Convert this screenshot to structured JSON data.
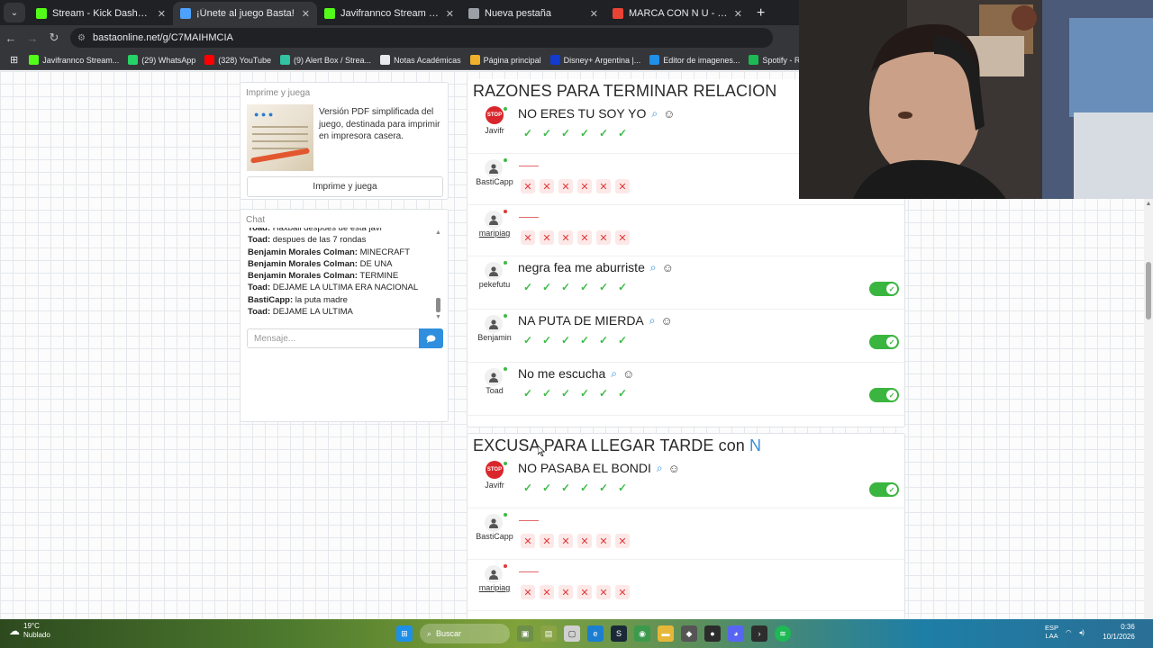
{
  "browser": {
    "tabs": [
      {
        "title": "Stream - Kick Dashboard",
        "favicon": "kick-icon",
        "color": "#53fc18",
        "active": false
      },
      {
        "title": "¡Únete al juego Basta!",
        "favicon": "basta-icon",
        "color": "#4ea1ff",
        "active": true
      },
      {
        "title": "Javifrannco Stream - Watch Live",
        "favicon": "kick-icon",
        "color": "#53fc18",
        "active": false
      },
      {
        "title": "Nueva pestaña",
        "favicon": "chrome-icon",
        "color": "#9aa0a6",
        "active": false
      },
      {
        "title": "MARCA CON N U - Buscar con Google",
        "favicon": "google-icon",
        "color": "#ea4335",
        "active": false
      }
    ],
    "url": "bastaonline.net/g/C7MAIHMCIA",
    "bookmarks": [
      {
        "label": "Javifrannco Stream...",
        "color": "#53fc18"
      },
      {
        "label": "(29) WhatsApp",
        "color": "#25d366"
      },
      {
        "label": "(328) YouTube",
        "color": "#ff0000"
      },
      {
        "label": "(9) Alert Box / Strea...",
        "color": "#31c3a2"
      },
      {
        "label": "Notas Académicas",
        "color": "#e8eaed"
      },
      {
        "label": "Página principal",
        "color": "#f2b12c"
      },
      {
        "label": "Disney+ Argentina |...",
        "color": "#113ccf"
      },
      {
        "label": "Editor de imagenes...",
        "color": "#1f8fe8"
      },
      {
        "label": "Spotify - Reproduct...",
        "color": "#1db954"
      }
    ]
  },
  "sidebar": {
    "print": {
      "heading": "Imprime y juega",
      "description": "Versión PDF simplificada del juego, destinada para imprimir en impresora casera.",
      "button": "Imprime y juega"
    },
    "chat": {
      "heading": "Chat",
      "messages": [
        {
          "user": "Toad:",
          "text": "Haxball despues de esta javi"
        },
        {
          "user": "Toad:",
          "text": "despues de las 7 rondas"
        },
        {
          "user": "Benjamin Morales Colman:",
          "text": "MINECRAFT"
        },
        {
          "user": "Benjamin Morales Colman:",
          "text": "DE UNA"
        },
        {
          "user": "Benjamin Morales Colman:",
          "text": "TERMINE"
        },
        {
          "user": "Toad:",
          "text": "DEJAME LA ULTIMA ERA NACIONAL"
        },
        {
          "user": "BastiCapp:",
          "text": "la puta madre"
        },
        {
          "user": "Toad:",
          "text": "DEJAME LA ULTIMA"
        }
      ],
      "placeholder": "Mensaje..."
    }
  },
  "categories": [
    {
      "title": "RAZONES PARA TERMINAR RELACION",
      "letter": "",
      "answers": [
        {
          "player": "Javifr",
          "answer": "NO ERES TU SOY YO",
          "result": "valid",
          "toggle": false,
          "status_color": "#3dbb48",
          "avatar": "stop"
        },
        {
          "player": "BastiCapp",
          "answer": "",
          "result": "invalid",
          "toggle": false,
          "status_color": "#3dbb48",
          "avatar": "default"
        },
        {
          "player": "maripiag",
          "answer": "",
          "result": "invalid",
          "toggle": false,
          "status_color": "#e23838",
          "avatar": "default"
        },
        {
          "player": "pekefutu",
          "answer": "negra fea me aburriste",
          "result": "valid",
          "toggle": true,
          "status_color": "#3dbb48",
          "avatar": "default"
        },
        {
          "player": "Benjamin",
          "answer": "NA PUTA DE MIERDA",
          "result": "valid",
          "toggle": true,
          "status_color": "#3dbb48",
          "avatar": "default"
        },
        {
          "player": "Toad",
          "answer": "No me escucha",
          "result": "valid",
          "toggle": true,
          "status_color": "#3dbb48",
          "avatar": "default"
        }
      ]
    },
    {
      "title": "EXCUSA PARA LLEGAR TARDE con",
      "letter": "N",
      "answers": [
        {
          "player": "Javifr",
          "answer": "NO PASABA EL BONDI",
          "result": "valid",
          "toggle": true,
          "status_color": "#3dbb48",
          "avatar": "stop"
        },
        {
          "player": "BastiCapp",
          "answer": "",
          "result": "invalid",
          "toggle": false,
          "status_color": "#3dbb48",
          "avatar": "default"
        },
        {
          "player": "maripiag",
          "answer": "",
          "result": "invalid",
          "toggle": false,
          "status_color": "#e23838",
          "avatar": "default"
        }
      ]
    }
  ],
  "taskbar": {
    "weather_temp": "19°C",
    "weather_text": "Nublado",
    "search": "Buscar",
    "lang": "ESP",
    "lang2": "LAA",
    "time": "0:36",
    "date": "10/1/2026"
  },
  "colors": {
    "valid": "#3dbb48",
    "invalid": "#e23838",
    "accent": "#3a8fd6",
    "toggle": "#3ab53f"
  }
}
